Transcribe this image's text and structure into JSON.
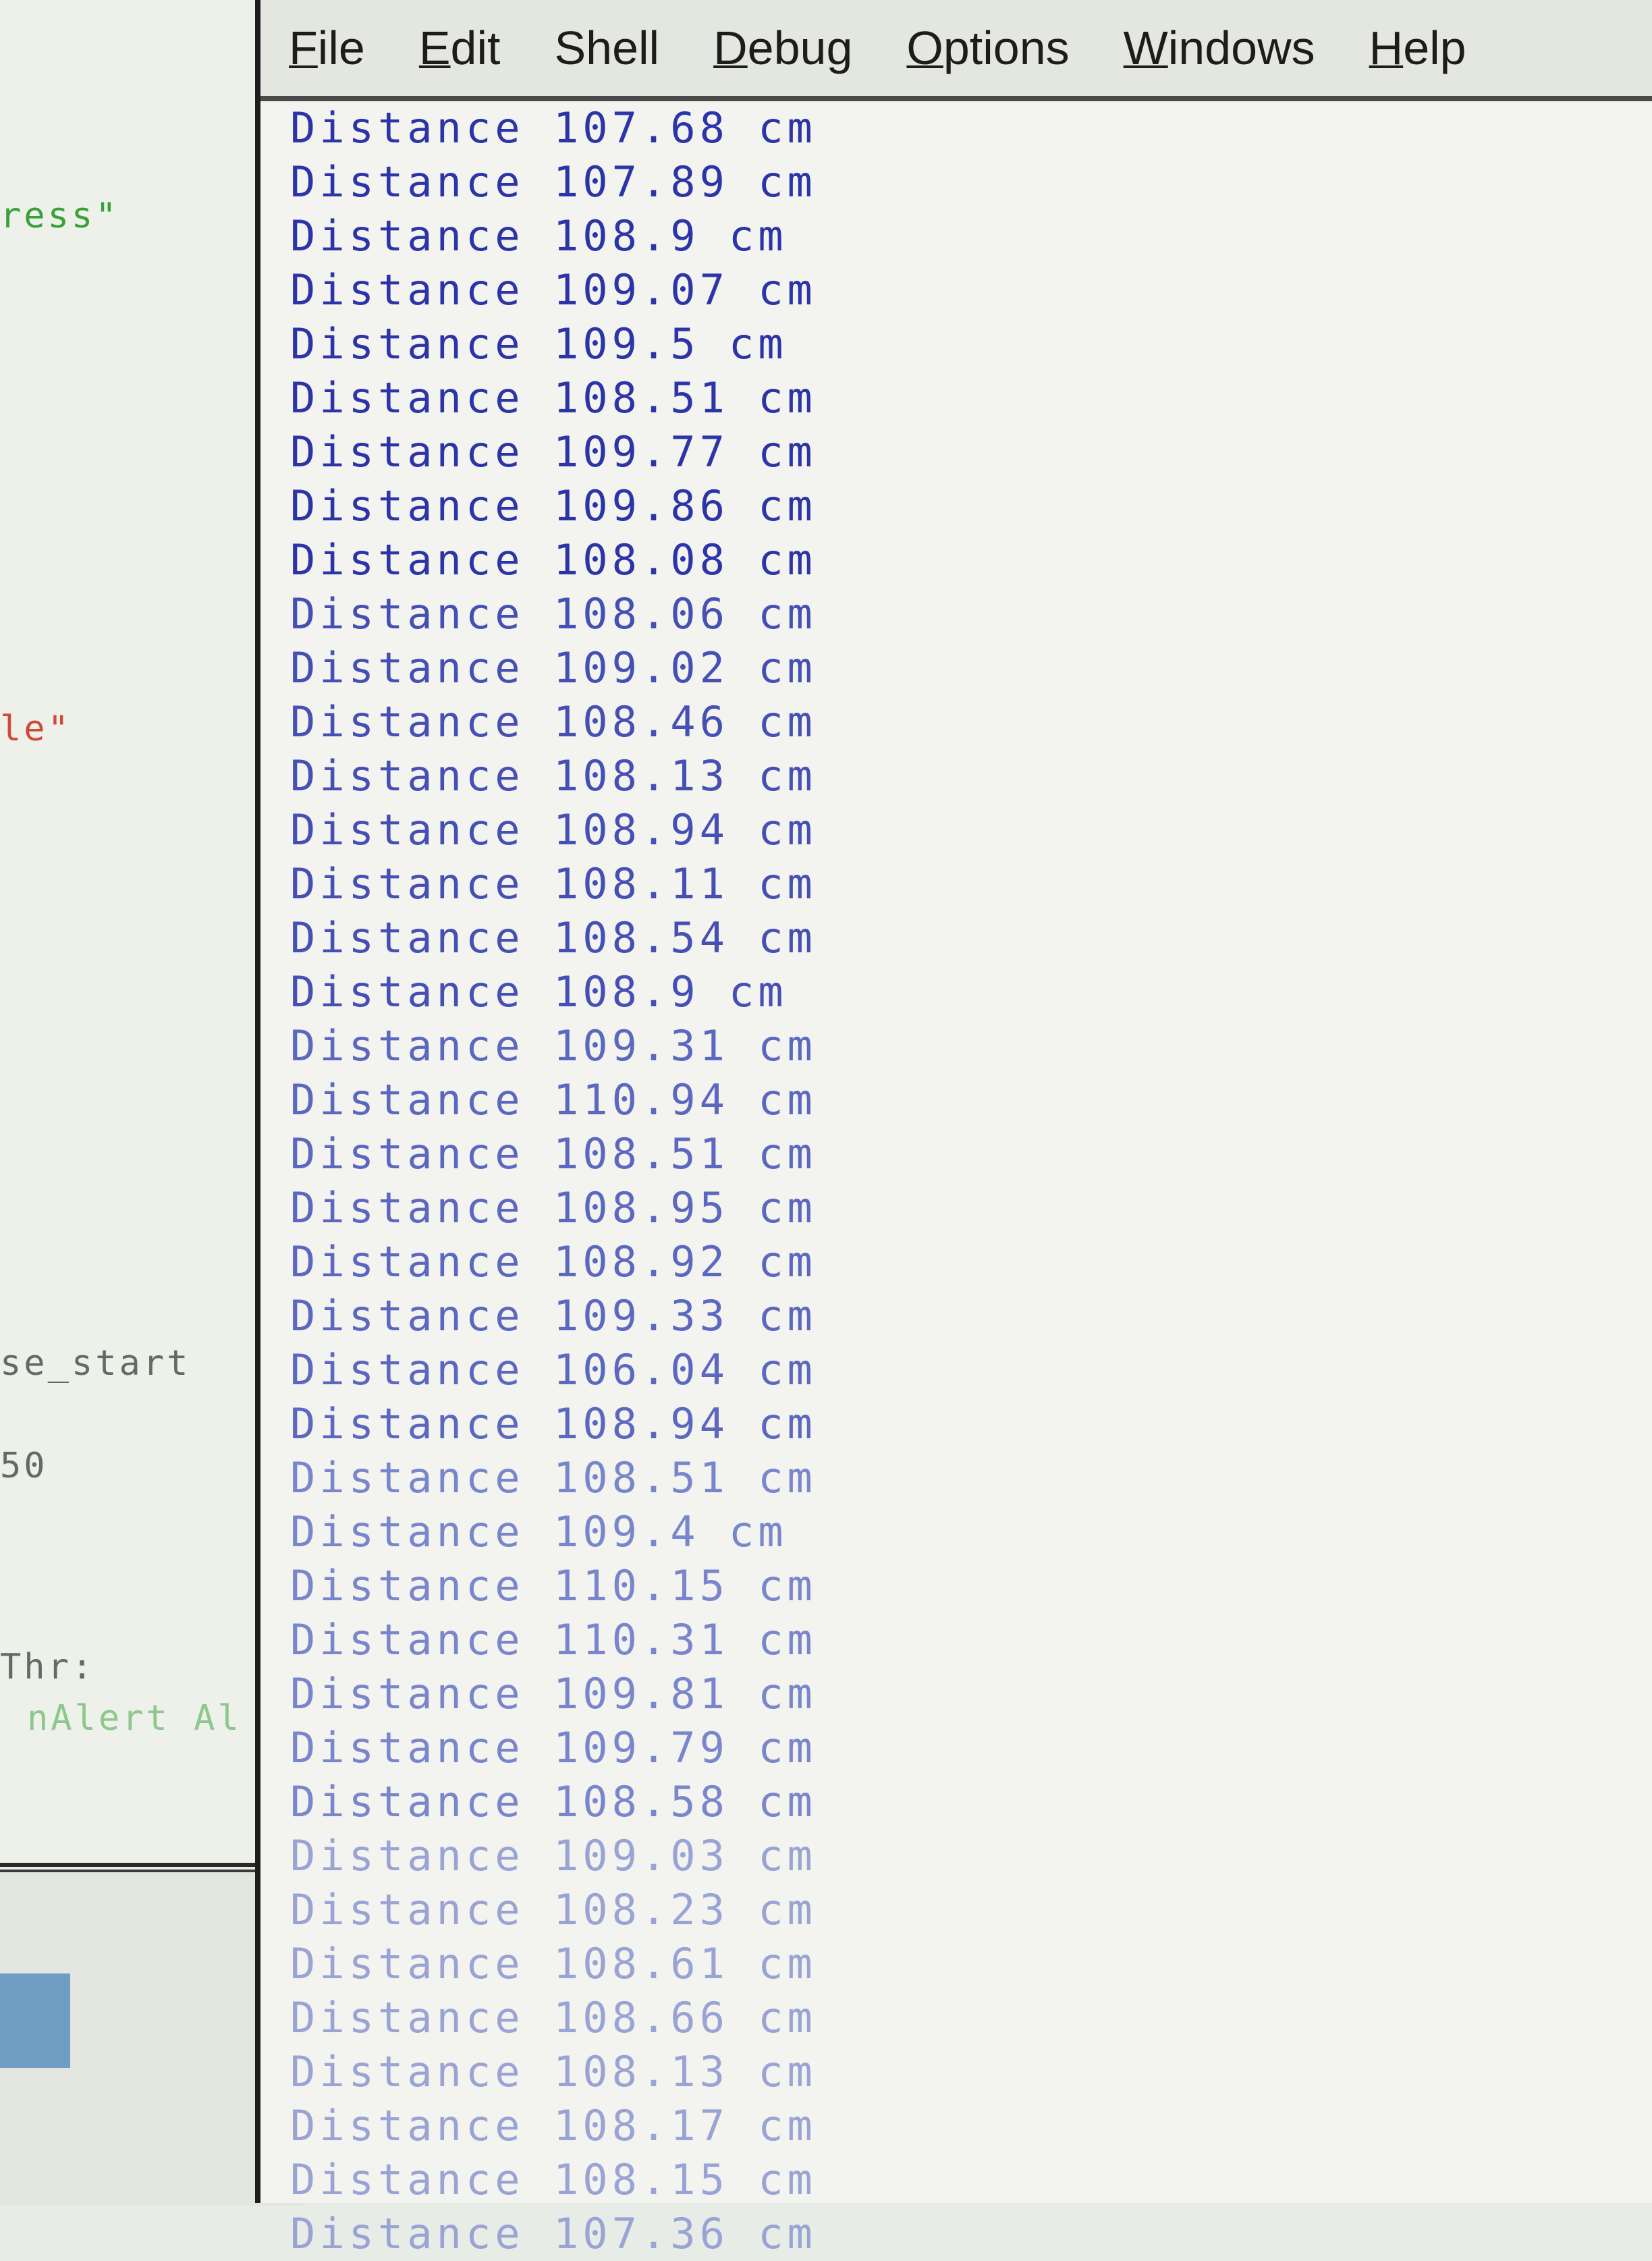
{
  "menubar": {
    "items": [
      {
        "acc": "F",
        "rest": "ile"
      },
      {
        "acc": "E",
        "rest": "dit"
      },
      {
        "acc": "",
        "rest": "Shell"
      },
      {
        "acc": "D",
        "rest": "ebug"
      },
      {
        "acc": "O",
        "rest": "ptions"
      },
      {
        "acc": "W",
        "rest": "indows"
      },
      {
        "acc": "H",
        "rest": "elp"
      }
    ]
  },
  "editor": {
    "frag1": "ress\"",
    "frag2": "le\"",
    "frag3": "se_start",
    "frag4": "50",
    "frag5": "Thr:",
    "frag6": "nAlert Al",
    "eq": "="
  },
  "shell": {
    "output": [
      "Distance 107.68 cm",
      "Distance 107.89 cm",
      "Distance 108.9 cm",
      "Distance 109.07 cm",
      "Distance 109.5 cm",
      "Distance 108.51 cm",
      "Distance 109.77 cm",
      "Distance 109.86 cm",
      "Distance 108.08 cm",
      "Distance 108.06 cm",
      "Distance 109.02 cm",
      "Distance 108.46 cm",
      "Distance 108.13 cm",
      "Distance 108.94 cm",
      "Distance 108.11 cm",
      "Distance 108.54 cm",
      "Distance 108.9 cm",
      "Distance 109.31 cm",
      "Distance 110.94 cm",
      "Distance 108.51 cm",
      "Distance 108.95 cm",
      "Distance 108.92 cm",
      "Distance 109.33 cm",
      "Distance 106.04 cm",
      "Distance 108.94 cm",
      "Distance 108.51 cm",
      "Distance 109.4 cm",
      "Distance 110.15 cm",
      "Distance 110.31 cm",
      "Distance 109.81 cm",
      "Distance 109.79 cm",
      "Distance 108.58 cm",
      "Distance 109.03 cm",
      "Distance 108.23 cm",
      "Distance 108.61 cm",
      "Distance 108.66 cm",
      "Distance 108.13 cm",
      "Distance 108.17 cm",
      "Distance 108.15 cm",
      "Distance 107.36 cm"
    ]
  }
}
